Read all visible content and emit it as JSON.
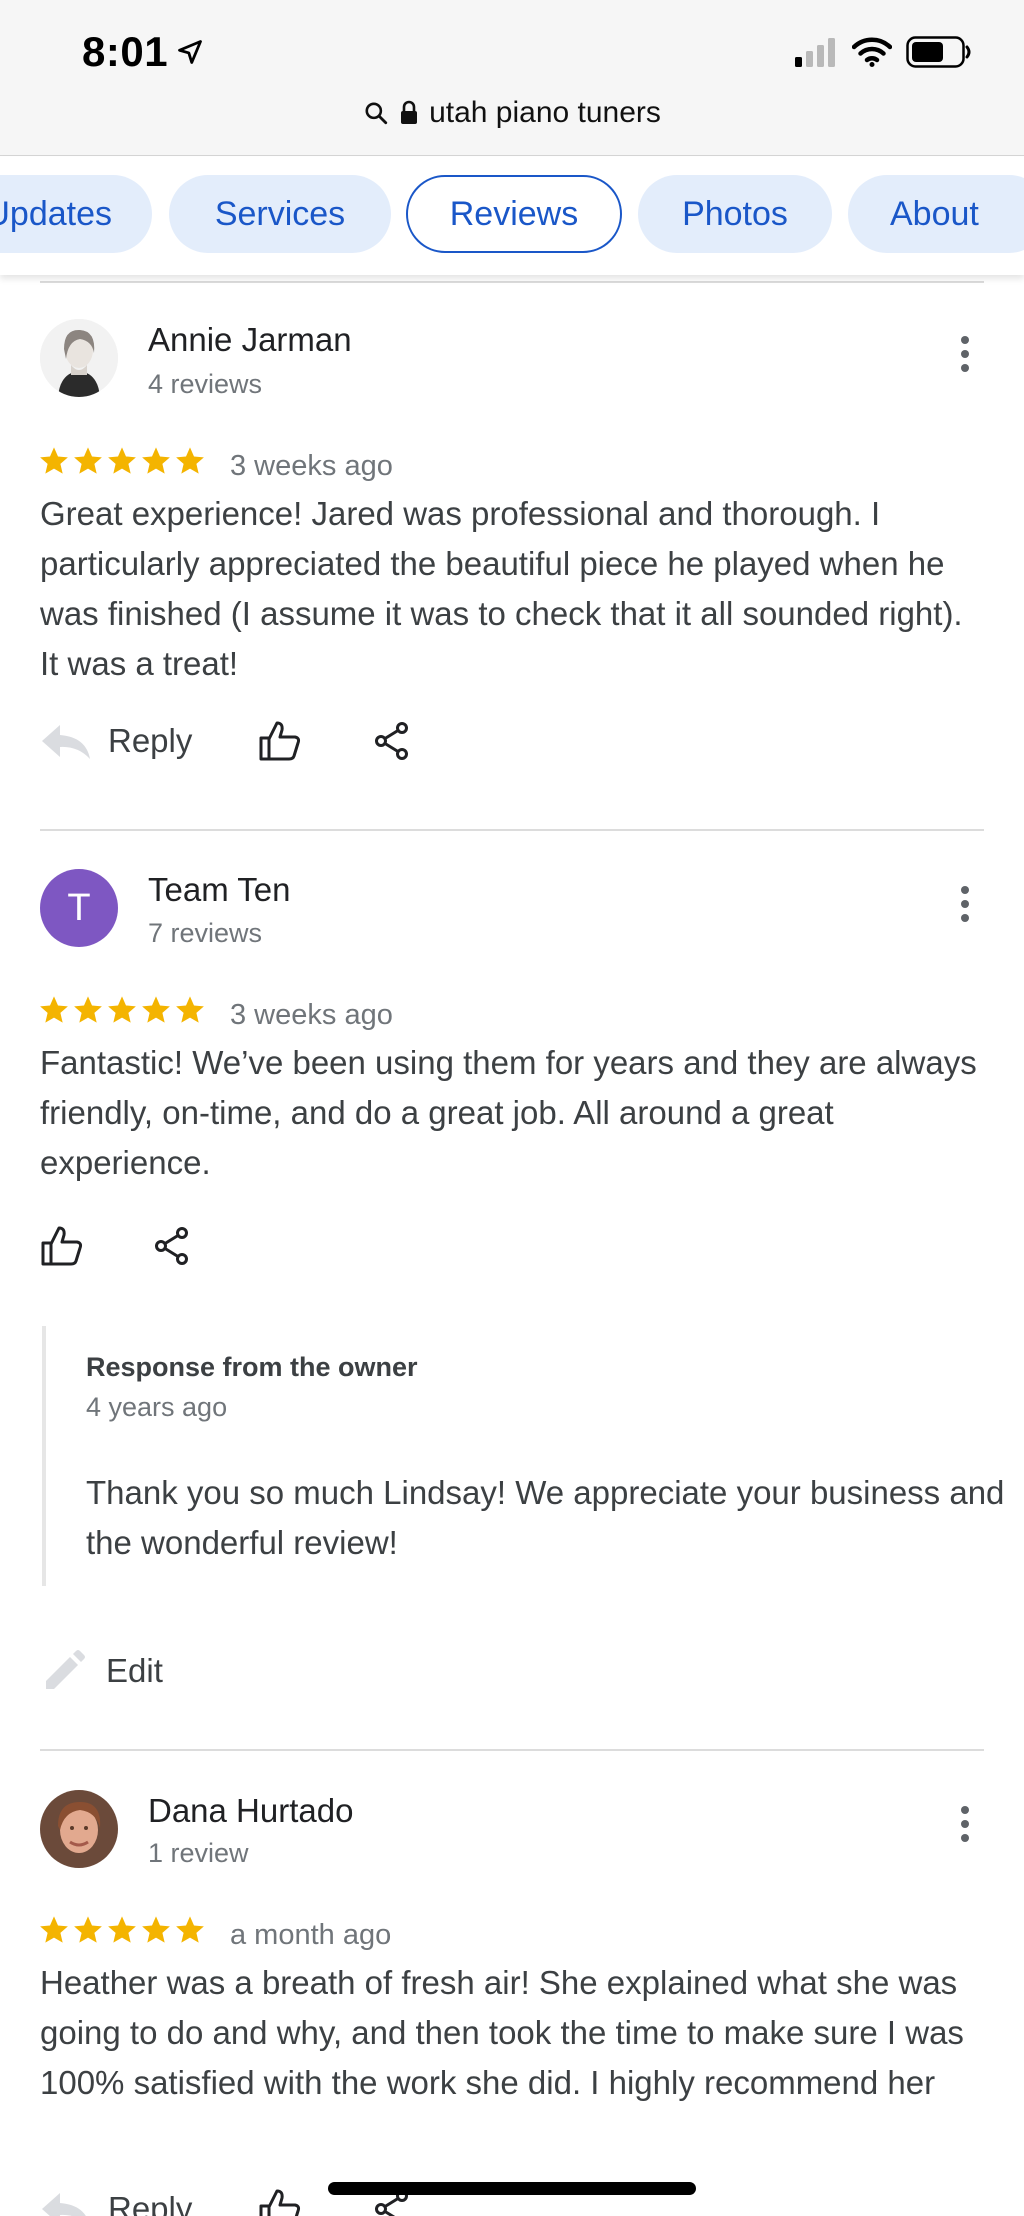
{
  "status": {
    "time": "8:01",
    "location_icon": "location-arrow-icon",
    "signal_icon": "cellular-signal-icon",
    "wifi_icon": "wifi-icon",
    "battery_icon": "battery-icon"
  },
  "browser": {
    "url": "utah piano tuners"
  },
  "tabs": [
    {
      "label": "Updates"
    },
    {
      "label": "Services"
    },
    {
      "label": "Reviews",
      "active": true
    },
    {
      "label": "Photos"
    },
    {
      "label": "About"
    }
  ],
  "colors": {
    "star": "#f4b400",
    "accent": "#1a57c8",
    "avatar_t": "#7e57c2"
  },
  "reviews": [
    {
      "name": "Annie Jarman",
      "count": "4 reviews",
      "rating": 5,
      "when": "3 weeks ago",
      "text": "Great experience!  Jared was professional and thorough.  I particularly appreciated the beautiful piece he played when he was finished (I assume it was to check that it all sounded right).  It was a treat!",
      "reply_label": "Reply"
    },
    {
      "name": "Team Ten",
      "initial": "T",
      "count": "7 reviews",
      "rating": 5,
      "when": "3 weeks ago",
      "text": "Fantastic! We’ve been using them for years and they are always friendly, on-time, and do a great job. All around a great experience.",
      "owner_response": {
        "title": "Response from the owner",
        "when": "4 years ago",
        "text": "Thank you so much Lindsay! We appreciate your business and the wonderful review!"
      },
      "edit_label": "Edit"
    },
    {
      "name": "Dana Hurtado",
      "count": "1 review",
      "rating": 5,
      "when": "a month ago",
      "text": "Heather was a breath of fresh air!  She explained what she was going to do and why, and then took the time to make sure I was 100% satisfied with the work she did.  I highly recommend her",
      "reply_label": "Reply"
    }
  ]
}
